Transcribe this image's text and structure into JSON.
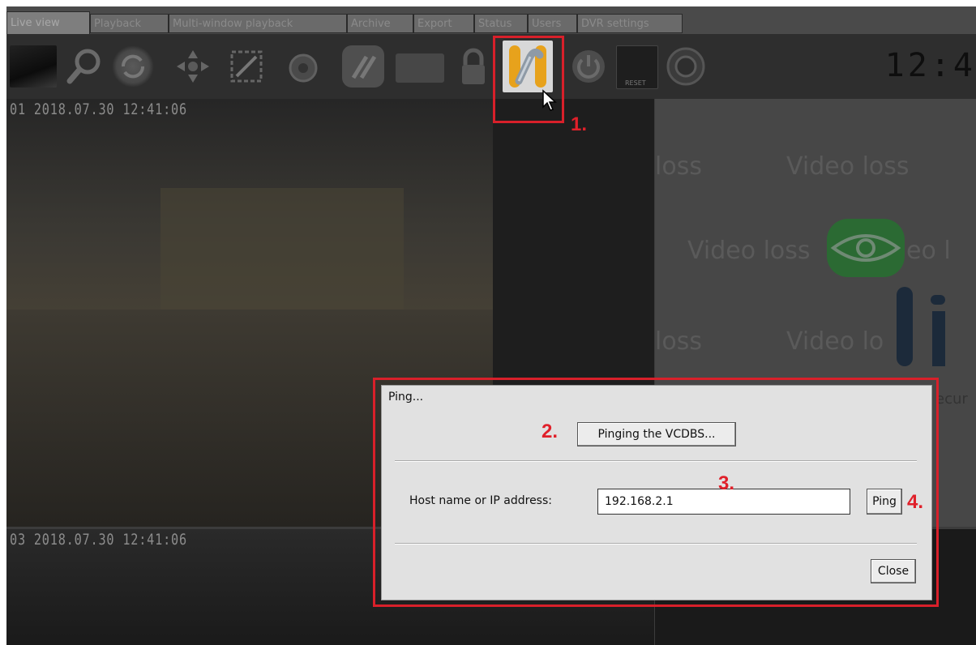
{
  "tabs": [
    {
      "label": "Live view",
      "active": true
    },
    {
      "label": "Playback"
    },
    {
      "label": "Multi-window playback"
    },
    {
      "label": "Archive"
    },
    {
      "label": "Export"
    },
    {
      "label": "Status"
    },
    {
      "label": "Users"
    },
    {
      "label": "DVR settings"
    }
  ],
  "toolbar": {
    "icons": [
      "monitor-icon",
      "search-icon",
      "refresh-icon",
      "ptz-arrows-icon",
      "zoom-area-icon",
      "snapshot-icon",
      "network-arrows-icon",
      "exit-icon",
      "lock-icon",
      "chain-link-icon",
      "power-icon",
      "reset-icon",
      "settings-dial-icon"
    ],
    "reset_text": "RESET",
    "clock": "12:4"
  },
  "panes": {
    "cam1_stamp": "01 2018.07.30 12:41:06",
    "cam3_stamp": "03 2018.07.30 12:41:06",
    "video_loss": "Video loss",
    "video_loss_partial_left": "loss",
    "video_loss_partial_right": "eo l",
    "video_loss_cut": "Video lo",
    "logo_text_fragment": "ecur"
  },
  "dialog": {
    "title": "Ping...",
    "ping_vcdbs_button": "Pinging the VCDBS...",
    "host_label": "Host name or IP address:",
    "host_value": "192.168.2.1",
    "ping_button": "Ping",
    "close_button": "Close"
  },
  "annotations": {
    "step1": "1.",
    "step2": "2.",
    "step3": "3.",
    "step4": "4."
  },
  "colors": {
    "highlight": "#d8202a",
    "logo_green": "#2e8b3a",
    "logo_navy": "#1c2a4a"
  }
}
